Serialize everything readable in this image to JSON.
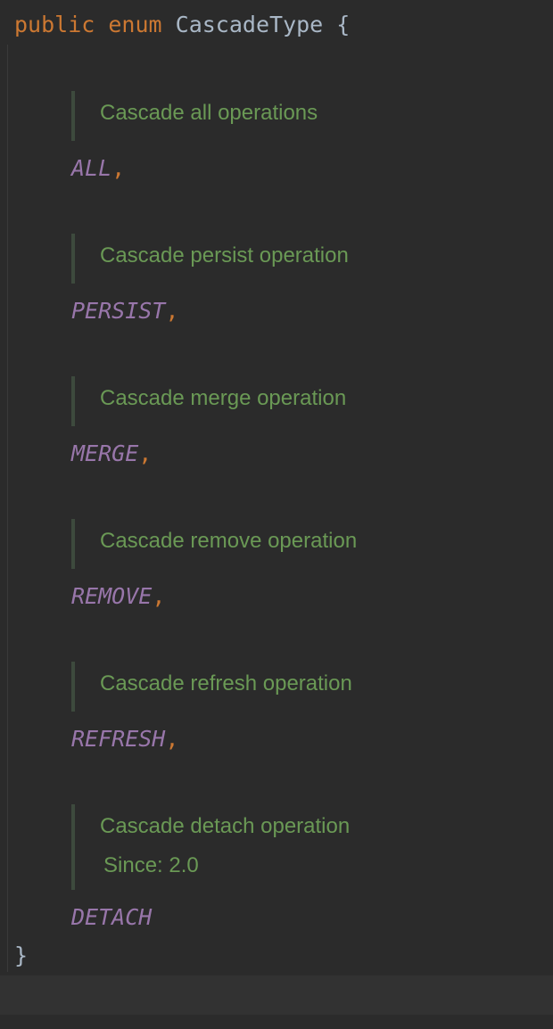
{
  "code": {
    "declaration": {
      "modifier": "public",
      "keyword": "enum",
      "name": "CascadeType",
      "open_brace": "{"
    },
    "close_brace": "}",
    "constants": [
      {
        "name": "ALL",
        "separator": ",",
        "doc": "Cascade all operations"
      },
      {
        "name": "PERSIST",
        "separator": ",",
        "doc": "Cascade persist operation"
      },
      {
        "name": "MERGE",
        "separator": ",",
        "doc": "Cascade merge operation"
      },
      {
        "name": "REMOVE",
        "separator": ",",
        "doc": "Cascade remove operation"
      },
      {
        "name": "REFRESH",
        "separator": ",",
        "doc": "Cascade refresh operation"
      },
      {
        "name": "DETACH",
        "separator": "",
        "doc": "Cascade detach operation",
        "since": "Since: 2.0"
      }
    ]
  }
}
